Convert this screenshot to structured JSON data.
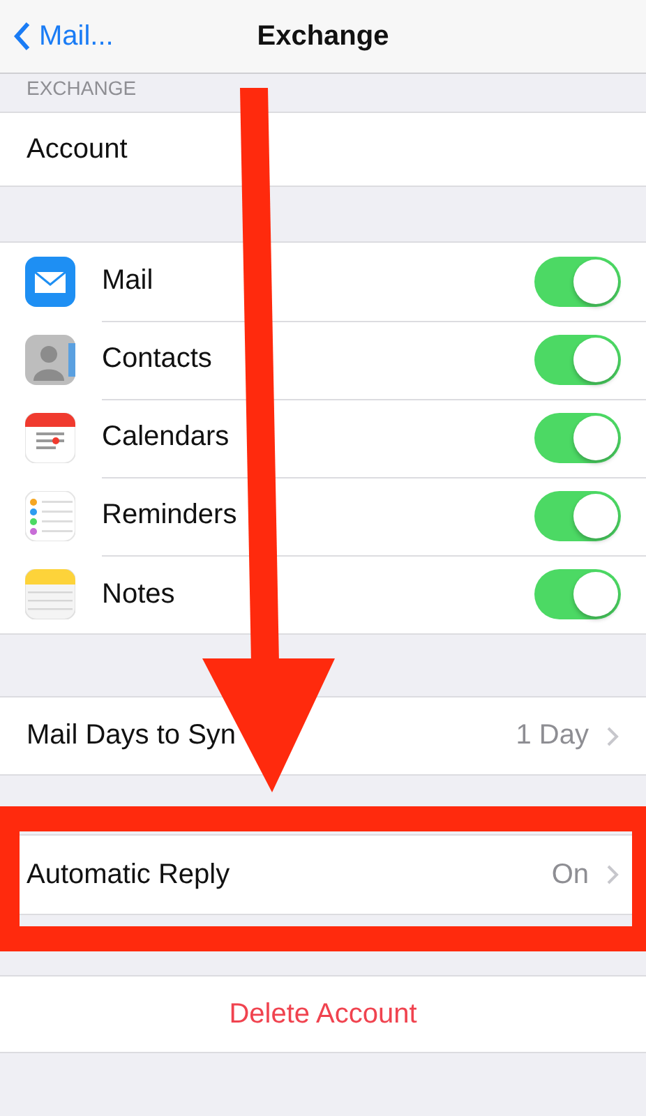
{
  "nav": {
    "back": "Mail...",
    "title": "Exchange"
  },
  "section_header": "EXCHANGE",
  "account_row": {
    "label": "Account"
  },
  "toggles": [
    {
      "label": "Mail",
      "on": true
    },
    {
      "label": "Contacts",
      "on": true
    },
    {
      "label": "Calendars",
      "on": true
    },
    {
      "label": "Reminders",
      "on": true
    },
    {
      "label": "Notes",
      "on": true
    }
  ],
  "detail_rows": [
    {
      "label": "Mail Days to Syn",
      "value": "1 Day",
      "highlighted": false
    },
    {
      "label": "Automatic Reply",
      "value": "On",
      "highlighted": true
    }
  ],
  "delete_button": "Delete Account"
}
